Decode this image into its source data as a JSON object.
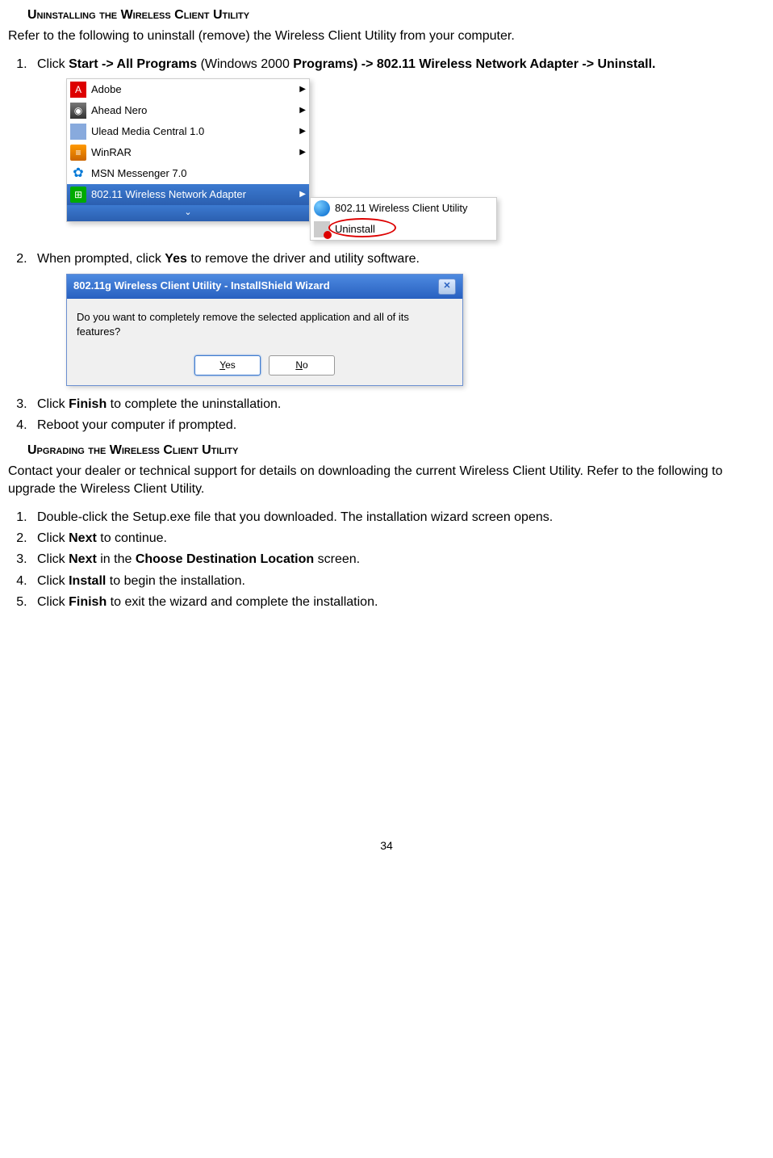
{
  "headings": {
    "uninstall": "Uninstalling the Wireless Client Utility",
    "upgrade": "Upgrading the Wireless Client Utility"
  },
  "text": {
    "uninstall_intro": "Refer to the following to uninstall (remove) the Wireless Client Utility from your computer.",
    "upgrade_intro": "Contact your dealer or technical support for details on downloading the current Wireless Client Utility. Refer to the following to upgrade the Wireless Client Utility."
  },
  "step_uninstall_1": {
    "prefix": "Click ",
    "b1": "Start -> All Programs ",
    "mid": "(Windows 2000 ",
    "b2": "Programs) -> 802.11 Wireless Network Adapter -> Uninstall."
  },
  "step_uninstall_2": {
    "prefix": "When prompted, click ",
    "b1": "Yes",
    "suffix": " to remove the driver and utility software."
  },
  "step_uninstall_3": {
    "prefix": "Click ",
    "b1": "Finish",
    "suffix": " to complete the uninstallation."
  },
  "step_uninstall_4": "Reboot your computer if prompted.",
  "step_upgrade_1": "Double-click the Setup.exe file that you downloaded. The installation wizard screen opens.",
  "step_upgrade_2": {
    "prefix": "Click ",
    "b1": "Next",
    "suffix": " to continue."
  },
  "step_upgrade_3": {
    "prefix": "Click ",
    "b1": "Next",
    "mid": " in the ",
    "b2": "Choose Destination Location",
    "suffix": " screen."
  },
  "step_upgrade_4": {
    "prefix": "Click ",
    "b1": "Install",
    "suffix": " to begin the installation."
  },
  "step_upgrade_5": {
    "prefix": "Click ",
    "b1": "Finish",
    "suffix": " to exit the wizard and complete the installation."
  },
  "menu": {
    "items": [
      "Adobe",
      "Ahead Nero",
      "Ulead Media Central 1.0",
      "WinRAR",
      "MSN Messenger 7.0",
      "802.11 Wireless Network Adapter"
    ],
    "submenu": [
      "802.11 Wireless Client Utility",
      "Uninstall"
    ]
  },
  "dialog": {
    "title": "802.11g Wireless Client Utility - InstallShield Wizard",
    "message": "Do you want to completely remove the selected application and all of its features?",
    "yes": "Yes",
    "no": "No"
  },
  "page_number": "34"
}
